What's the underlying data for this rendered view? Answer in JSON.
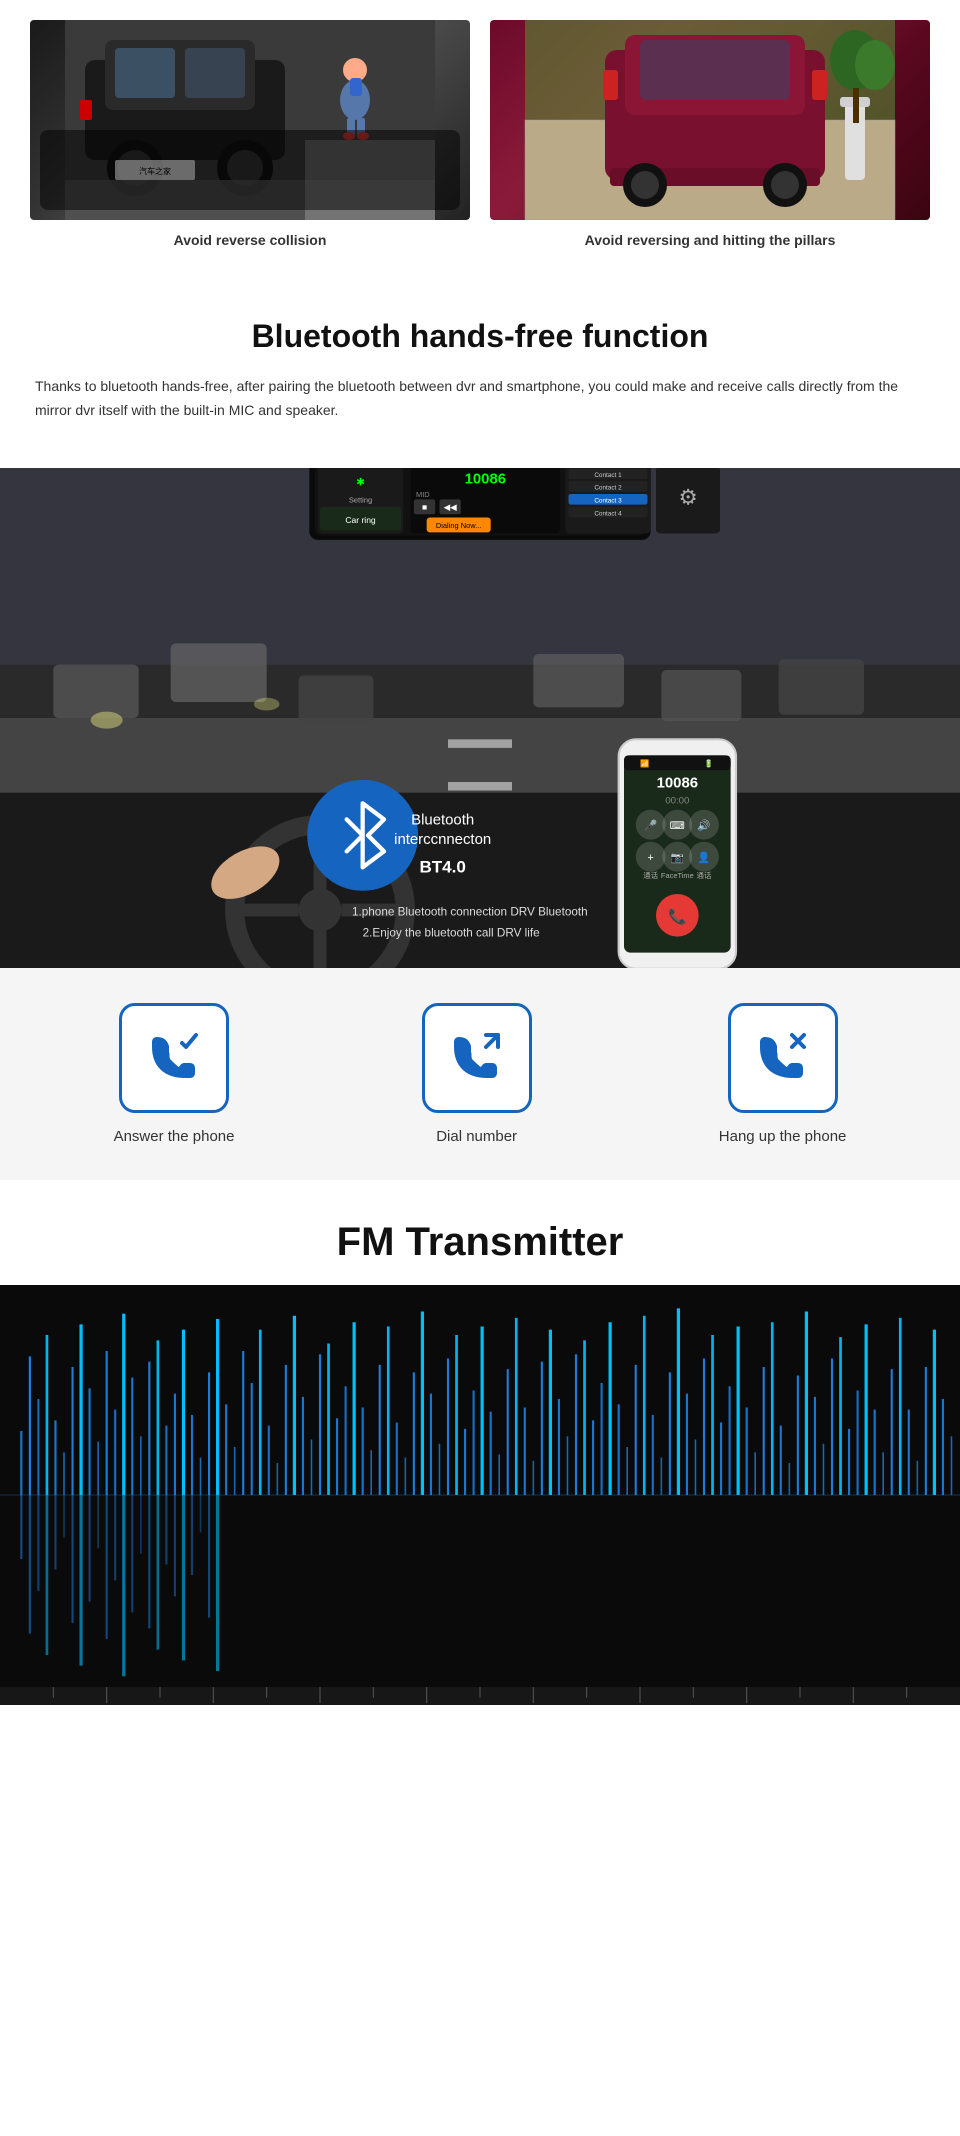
{
  "top_section": {
    "car_left": {
      "caption": "Avoid reverse collision",
      "alt": "Black car reversing with child nearby"
    },
    "car_right": {
      "caption": "Avoid reversing and hitting the pillars",
      "alt": "Purple car near pillar"
    }
  },
  "bluetooth_section": {
    "title": "Bluetooth hands-free function",
    "description": "Thanks to bluetooth hands-free, after pairing the bluetooth between dvr and smartphone, you could make and receive calls directly from the mirror dvr itself with the built-in MIC and speaker.",
    "mirror_number": "10086",
    "mirror_dialing": "Dialing Now...",
    "bt_text_line1": "Bluetooth",
    "bt_text_line2": "interccnnecton",
    "bt_version": "BT4.0",
    "instruction_1": "1.phone Bluetooth connection DRV Bluetooth",
    "instruction_2": "2.Enjoy the bluetooth call DRV life",
    "phone_number": "10086",
    "phone_timer": "00:00"
  },
  "phone_actions": [
    {
      "id": "answer",
      "label": "Answer the phone",
      "icon_type": "phone-check"
    },
    {
      "id": "dial",
      "label": "Dial number",
      "icon_type": "phone-arrow-up"
    },
    {
      "id": "hangup",
      "label": "Hang up the phone",
      "icon_type": "phone-x"
    }
  ],
  "fm_section": {
    "title": "FM Transmitter"
  },
  "colors": {
    "blue": "#1565C0",
    "light_blue_wave": "#1E90FF",
    "dark_bg": "#0a0a0a"
  }
}
